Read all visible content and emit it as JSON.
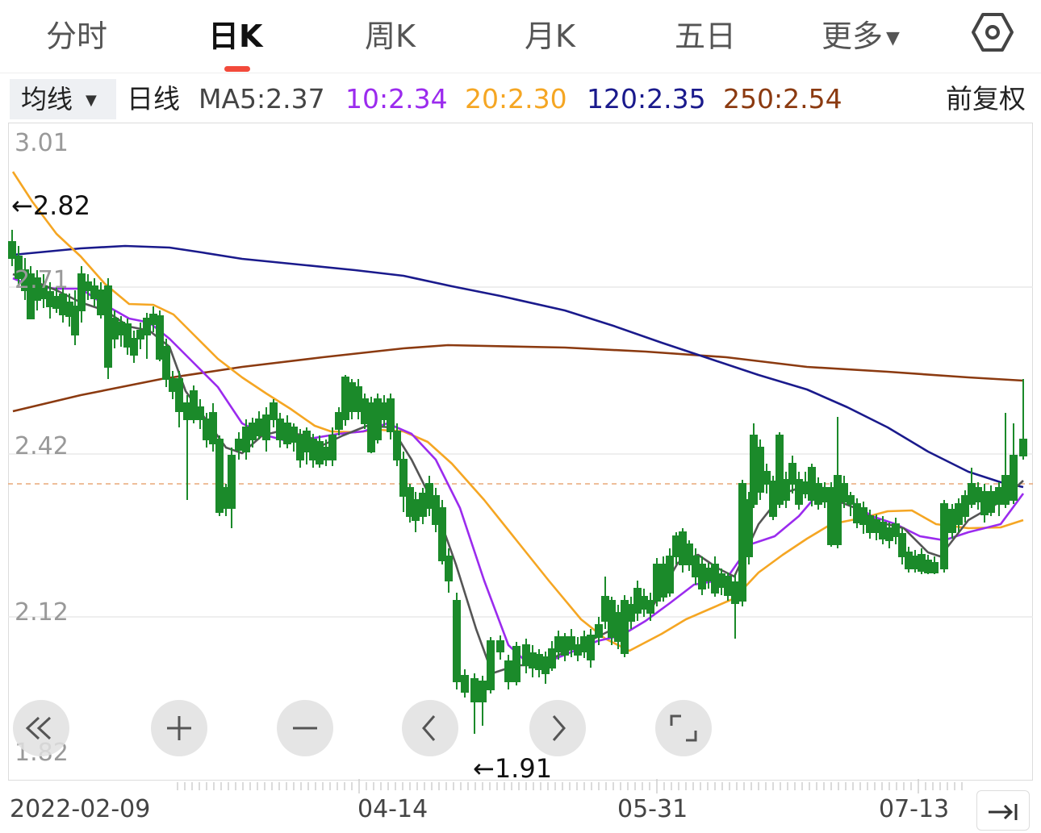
{
  "tabs": [
    {
      "label": "分时",
      "active": false
    },
    {
      "label": "日K",
      "active": true
    },
    {
      "label": "周K",
      "active": false
    },
    {
      "label": "月K",
      "active": false
    },
    {
      "label": "五日",
      "active": false
    },
    {
      "label": "更多",
      "active": false
    }
  ],
  "settings_icon": "hexagon-gear-icon",
  "ma_bar": {
    "dropdown_label": "均线",
    "period": "日线",
    "ma5": "MA5:2.37",
    "ma10": "10:2.34",
    "ma20": "20:2.30",
    "ma120": "120:2.35",
    "ma250": "250:2.54",
    "adjust": "前复权"
  },
  "colors": {
    "ma5": "#555555",
    "ma10": "#9b2bee",
    "ma20": "#f5a623",
    "ma120": "#1a1a8c",
    "ma250": "#8b3a10",
    "up": "#e0272b",
    "down": "#1b8a2a",
    "last_price_line": "#e8a878"
  },
  "chart_data": {
    "type": "candlestick",
    "y_ticks": [
      "3.01",
      "2.71",
      "2.42",
      "2.12",
      "1.82"
    ],
    "high_label": "←2.82",
    "low_label": "←1.91",
    "x_labels": [
      "2022-02-09",
      "04-14",
      "05-31",
      "07-13"
    ],
    "last_price": 2.36,
    "ma": {
      "ma5": 2.37,
      "ma10": 2.34,
      "ma20": 2.3,
      "ma120": 2.35,
      "ma250": 2.54
    }
  },
  "controls": [
    "fast-rewind-icon",
    "zoom-in-icon",
    "zoom-out-icon",
    "prev-icon",
    "next-icon",
    "fullscreen-icon"
  ],
  "jump_icon": "jump-to-latest-icon"
}
